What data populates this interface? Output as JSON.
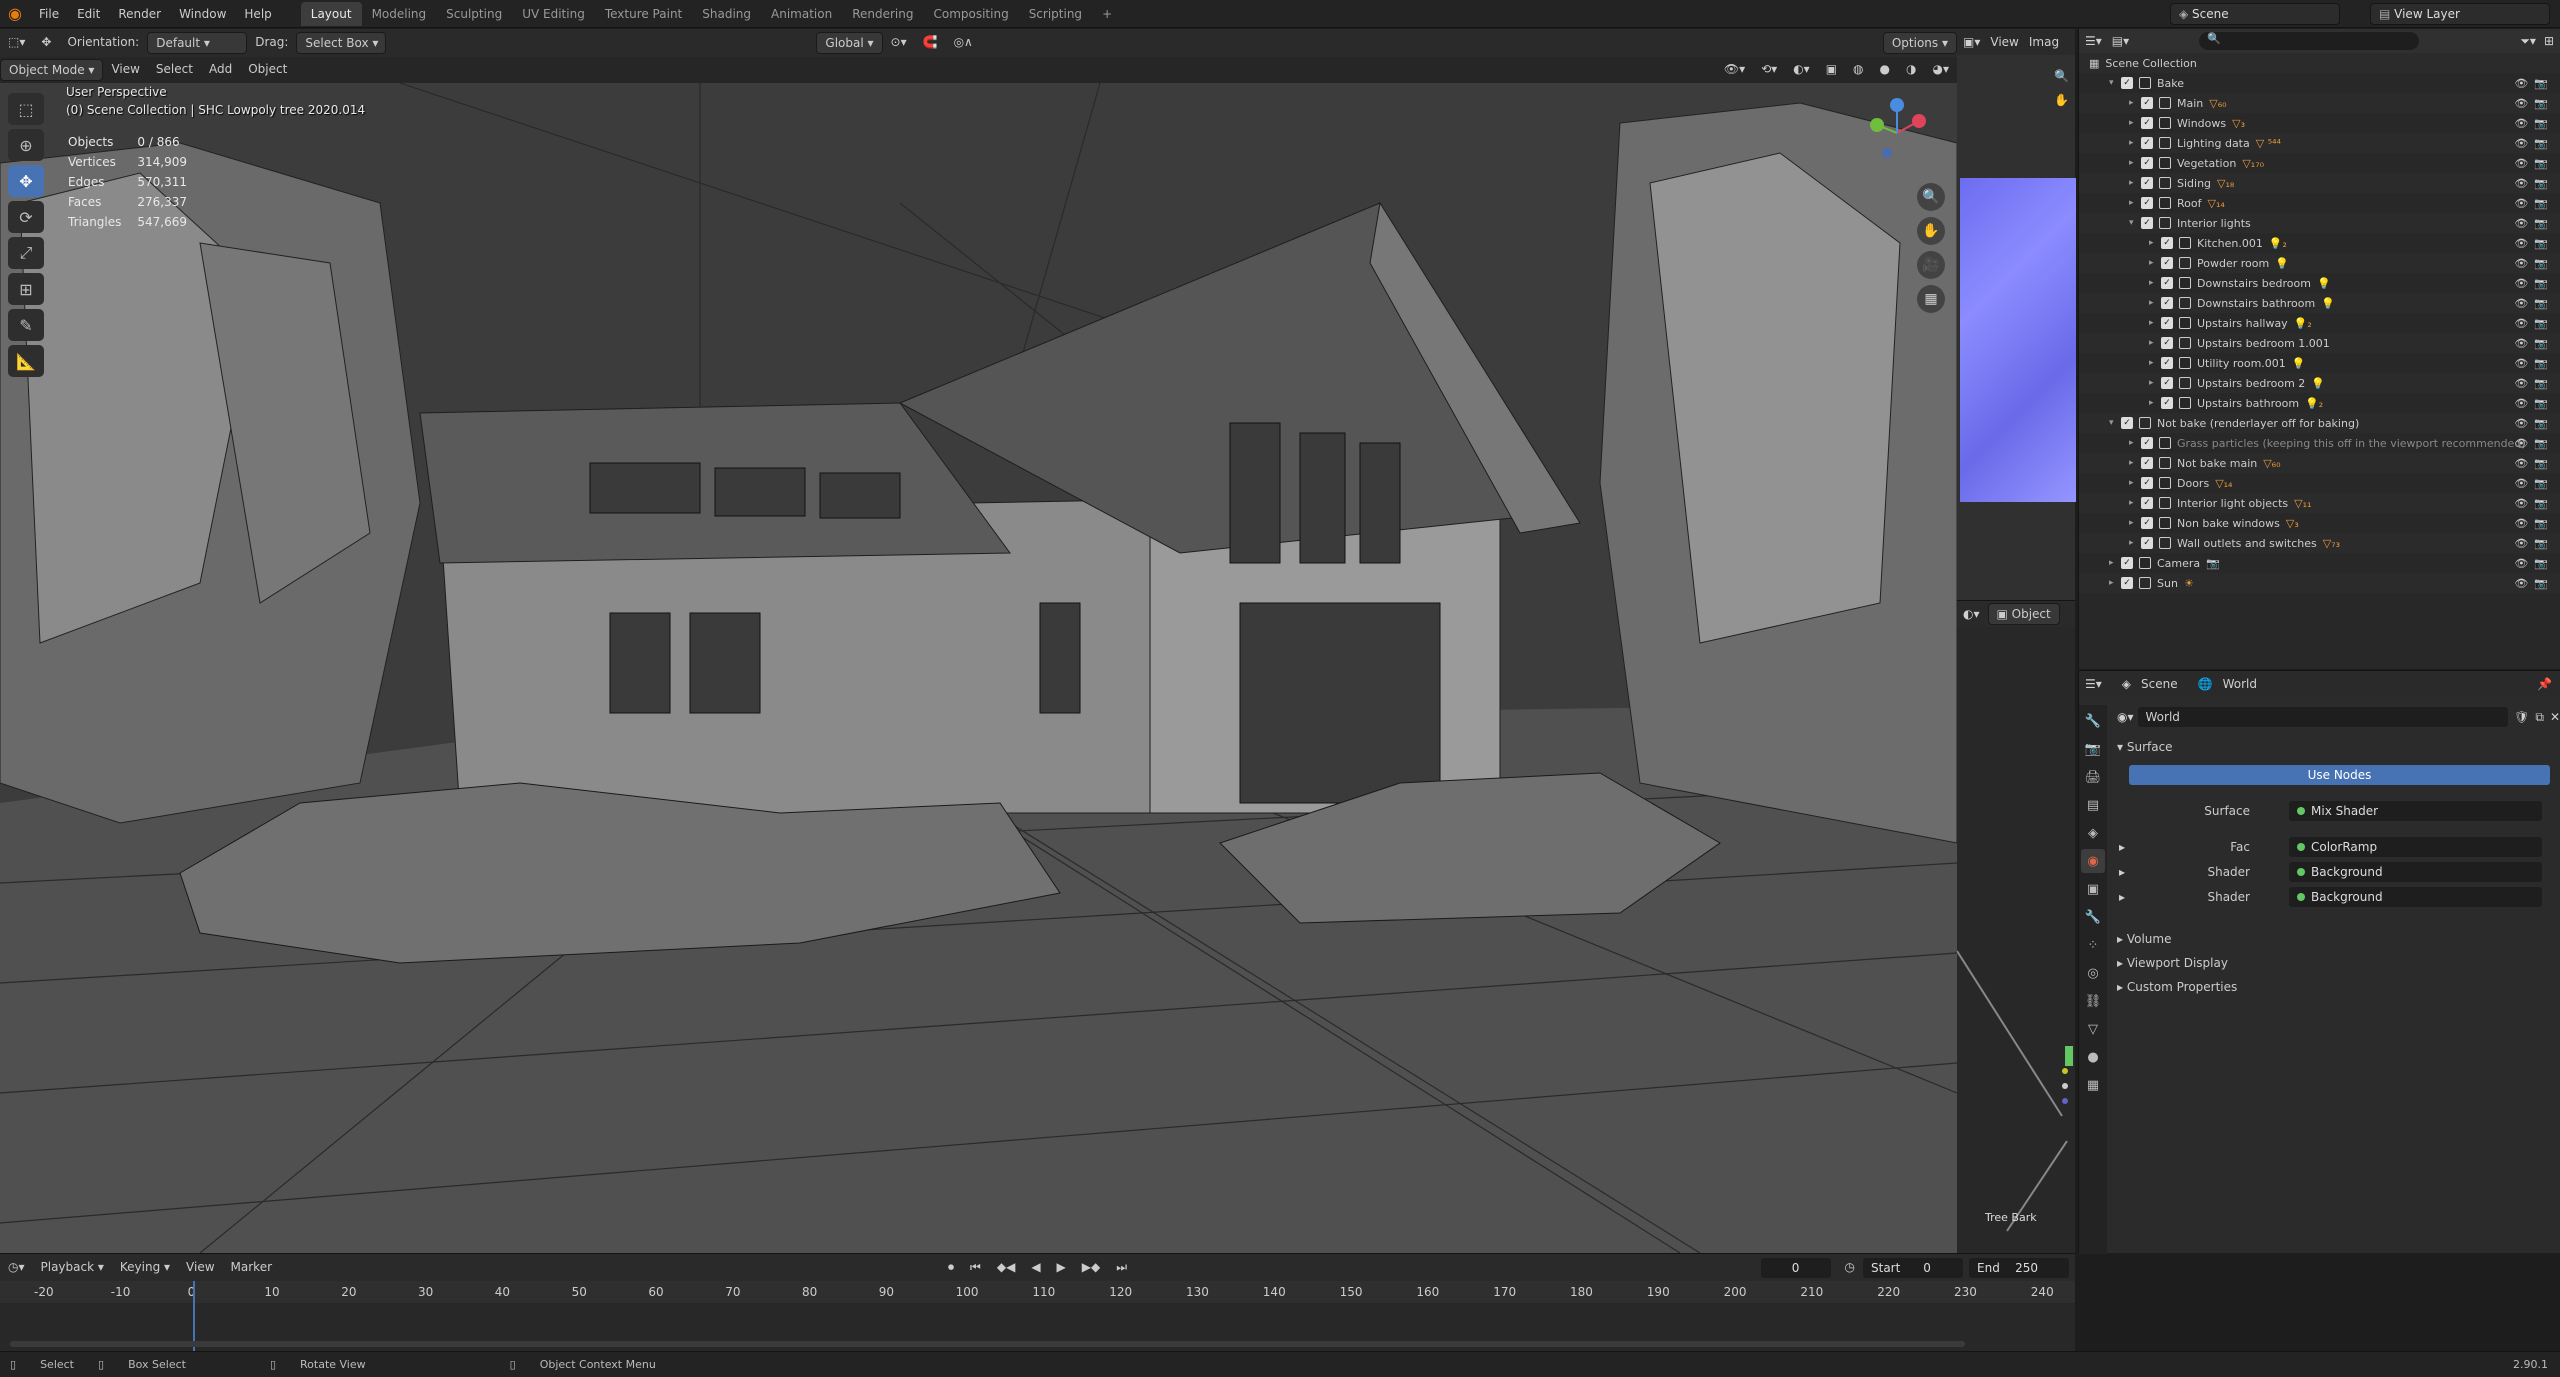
{
  "menubar": {
    "items": [
      "File",
      "Edit",
      "Render",
      "Window",
      "Help"
    ],
    "workspaces": [
      "Layout",
      "Modeling",
      "Sculpting",
      "UV Editing",
      "Texture Paint",
      "Shading",
      "Animation",
      "Rendering",
      "Compositing",
      "Scripting"
    ],
    "active_workspace": "Layout",
    "add_tab": "+",
    "scene_label": "Scene",
    "view_layer_label": "View Layer"
  },
  "viewport_header": {
    "orientation_label": "Orientation:",
    "orientation_value": "Default",
    "drag_label": "Drag:",
    "drag_value": "Select Box",
    "transform_space": "Global",
    "options": "Options"
  },
  "viewport_header2": {
    "mode": "Object Mode",
    "menus": [
      "View",
      "Select",
      "Add",
      "Object"
    ]
  },
  "viewport": {
    "perspective": "User Perspective",
    "collection_info": "(0) Scene Collection | SHC Lowpoly tree 2020.014",
    "stats": [
      {
        "label": "Objects",
        "value": "0 / 866"
      },
      {
        "label": "Vertices",
        "value": "314,909"
      },
      {
        "label": "Edges",
        "value": "570,311"
      },
      {
        "label": "Faces",
        "value": "276,337"
      },
      {
        "label": "Triangles",
        "value": "547,669"
      }
    ]
  },
  "image_editor": {
    "menus": [
      "View",
      "Imag"
    ]
  },
  "node_editor": {
    "object_label": "Object",
    "node_label": "Tree Bark"
  },
  "outliner": {
    "root": "Scene Collection",
    "rows": [
      {
        "indent": 1,
        "label": "Bake",
        "badge": "",
        "expanded": true
      },
      {
        "indent": 2,
        "label": "Main",
        "badge": "▽₆₀",
        "expanded": false
      },
      {
        "indent": 2,
        "label": "Windows",
        "badge": "▽₃",
        "expanded": false
      },
      {
        "indent": 2,
        "label": "Lighting data",
        "badge": "▽ ⁵⁴⁴",
        "expanded": false
      },
      {
        "indent": 2,
        "label": "Vegetation",
        "badge": "▽₁₇₀",
        "expanded": false
      },
      {
        "indent": 2,
        "label": "Siding",
        "badge": "▽₁₈",
        "expanded": false
      },
      {
        "indent": 2,
        "label": "Roof",
        "badge": "▽₁₄",
        "expanded": false
      },
      {
        "indent": 2,
        "label": "Interior lights",
        "badge": "",
        "expanded": true
      },
      {
        "indent": 3,
        "label": "Kitchen.001",
        "badge": "💡₂",
        "expanded": false
      },
      {
        "indent": 3,
        "label": "Powder room",
        "badge": "💡",
        "expanded": false
      },
      {
        "indent": 3,
        "label": "Downstairs bedroom",
        "badge": "💡",
        "expanded": false
      },
      {
        "indent": 3,
        "label": "Downstairs bathroom",
        "badge": "💡",
        "expanded": false
      },
      {
        "indent": 3,
        "label": "Upstairs hallway",
        "badge": "💡₂",
        "expanded": false
      },
      {
        "indent": 3,
        "label": "Upstairs bedroom 1.001",
        "badge": "",
        "expanded": false
      },
      {
        "indent": 3,
        "label": "Utility room.001",
        "badge": "💡",
        "expanded": false
      },
      {
        "indent": 3,
        "label": "Upstairs bedroom 2",
        "badge": "💡",
        "expanded": false
      },
      {
        "indent": 3,
        "label": "Upstairs bathroom",
        "badge": "💡₂",
        "expanded": false
      },
      {
        "indent": 1,
        "label": "Not bake (renderlayer off for baking)",
        "badge": "",
        "expanded": true
      },
      {
        "indent": 2,
        "label": "Grass particles (keeping this off in the viewport recommended)",
        "badge": "",
        "expanded": false,
        "dim": true
      },
      {
        "indent": 2,
        "label": "Not bake main",
        "badge": "▽₆₀",
        "expanded": false
      },
      {
        "indent": 2,
        "label": "Doors",
        "badge": "▽₁₄",
        "expanded": false
      },
      {
        "indent": 2,
        "label": "Interior light objects",
        "badge": "▽₁₁",
        "expanded": false
      },
      {
        "indent": 2,
        "label": "Non bake windows",
        "badge": "▽₃",
        "expanded": false
      },
      {
        "indent": 2,
        "label": "Wall outlets and switches",
        "badge": "▽₇₃",
        "expanded": false
      },
      {
        "indent": 1,
        "label": "Camera",
        "badge": "📷",
        "expanded": false
      },
      {
        "indent": 1,
        "label": "Sun",
        "badge": "☀",
        "expanded": false
      }
    ]
  },
  "properties": {
    "breadcrumb_scene": "Scene",
    "breadcrumb_world": "World",
    "world_name": "World",
    "surface_panel": "Surface",
    "use_nodes": "Use Nodes",
    "fields": [
      {
        "label": "Surface",
        "value": "Mix Shader"
      },
      {
        "label": "Fac",
        "value": "ColorRamp"
      },
      {
        "label": "Shader",
        "value": "Background"
      },
      {
        "label": "Shader",
        "value": "Background"
      }
    ],
    "collapsed_panels": [
      "Volume",
      "Viewport Display",
      "Custom Properties"
    ]
  },
  "timeline": {
    "menus": [
      "Playback",
      "Keying",
      "View",
      "Marker"
    ],
    "current_frame": "0",
    "start_label": "Start",
    "start_value": "0",
    "end_label": "End",
    "end_value": "250",
    "ruler_ticks": [
      "-20",
      "-10",
      "0",
      "10",
      "20",
      "30",
      "40",
      "50",
      "60",
      "70",
      "80",
      "90",
      "100",
      "110",
      "120",
      "130",
      "140",
      "150",
      "160",
      "170",
      "180",
      "190",
      "200",
      "210",
      "220",
      "230",
      "240"
    ]
  },
  "statusbar": {
    "select": "Select",
    "box_select": "Box Select",
    "rotate": "Rotate View",
    "context": "Object Context Menu",
    "version": "2.90.1"
  },
  "colors": {
    "accent": "#4772b3",
    "outliner_badge": "#e79a3c",
    "socket_green": "#63c763",
    "image_preview": "#7a7aff"
  }
}
